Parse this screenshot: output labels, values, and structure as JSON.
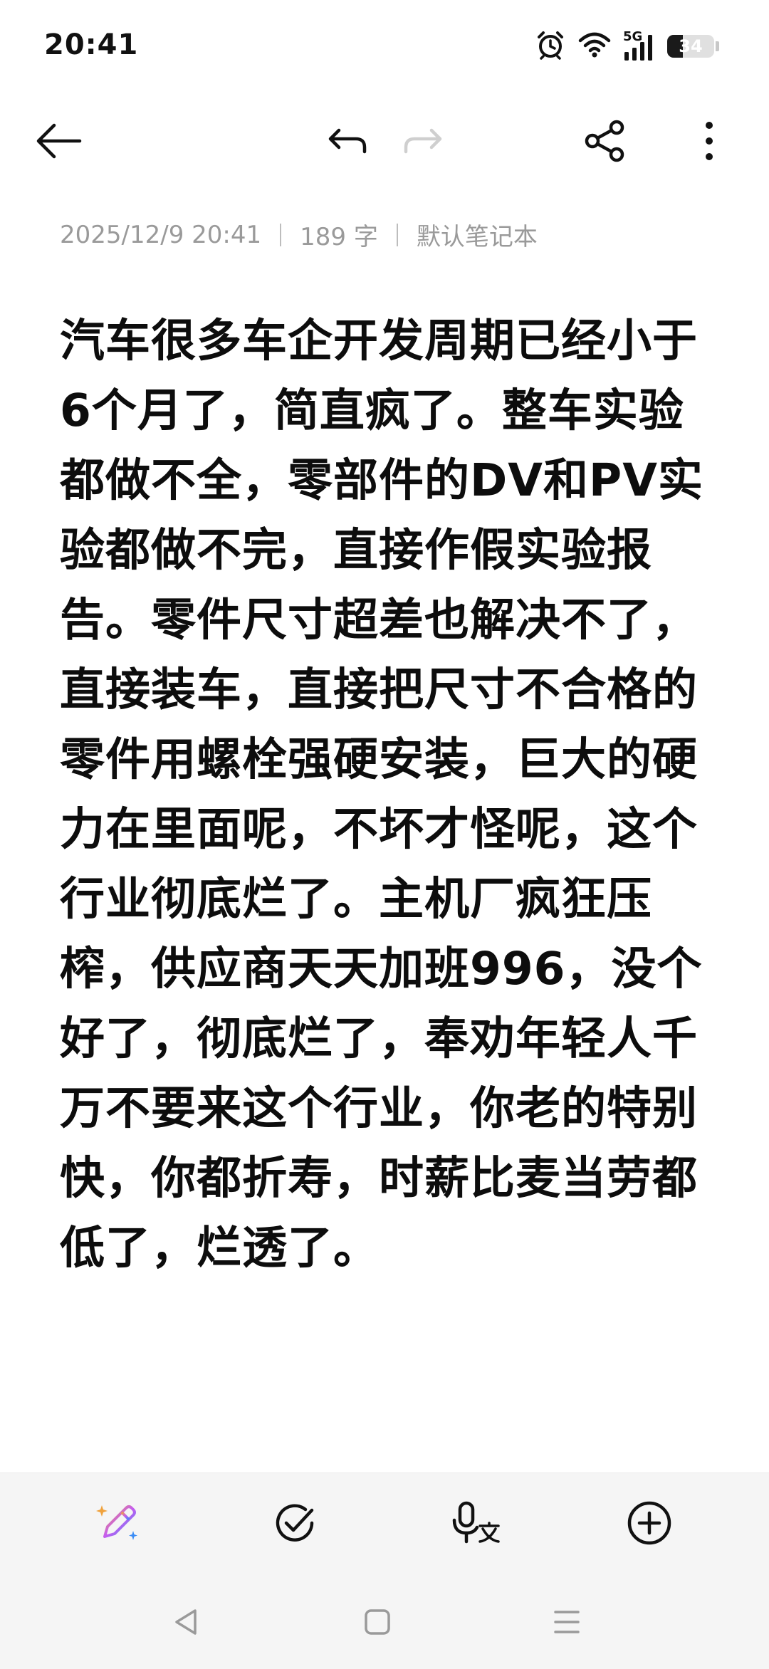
{
  "status_bar": {
    "time": "20:41",
    "network": "5G",
    "battery": "34",
    "battery_level_percent": 34,
    "icons": [
      "alarm-icon",
      "wifi-icon",
      "signal-icon",
      "battery-icon"
    ]
  },
  "toolbar": {
    "icons": [
      "back-arrow-icon",
      "undo-icon",
      "redo-icon",
      "share-icon",
      "more-vert-icon"
    ],
    "redo_enabled": false
  },
  "note": {
    "date": "2025/12/9 20:41",
    "word_count": "189 字",
    "notebook": "默认笔记本",
    "body": "汽车很多车企开发周期已经小于6个月了，简直疯了。整车实验都做不全，零部件的DV和PV实验都做不完，直接作假实验报告。零件尺寸超差也解决不了，直接装车，直接把尺寸不合格的零件用螺栓强硬安装，巨大的硬力在里面呢，不坏才怪呢，这个行业彻底烂了。主机厂疯狂压榨，供应商天天加班996，没个好了，彻底烂了，奉劝年轻人千万不要来这个行业，你老的特别快，你都折寿，时薪比麦当劳都低了，烂透了。"
  },
  "bottom_bar": {
    "icons": [
      "ai-pen-icon",
      "checklist-icon",
      "voice-to-text-icon",
      "add-icon"
    ]
  },
  "nav_bar": {
    "icons": [
      "nav-back-icon",
      "nav-home-icon",
      "nav-recents-icon"
    ]
  },
  "colors": {
    "background": "#ffffff",
    "text": "#0d0d0d",
    "meta_text": "#9a9a9a",
    "bottom_bar_bg": "#f5f5f5",
    "ai_gradient_start": "#f0a23c",
    "ai_gradient_mid": "#c65cf0",
    "ai_gradient_end": "#3a8cf5"
  }
}
